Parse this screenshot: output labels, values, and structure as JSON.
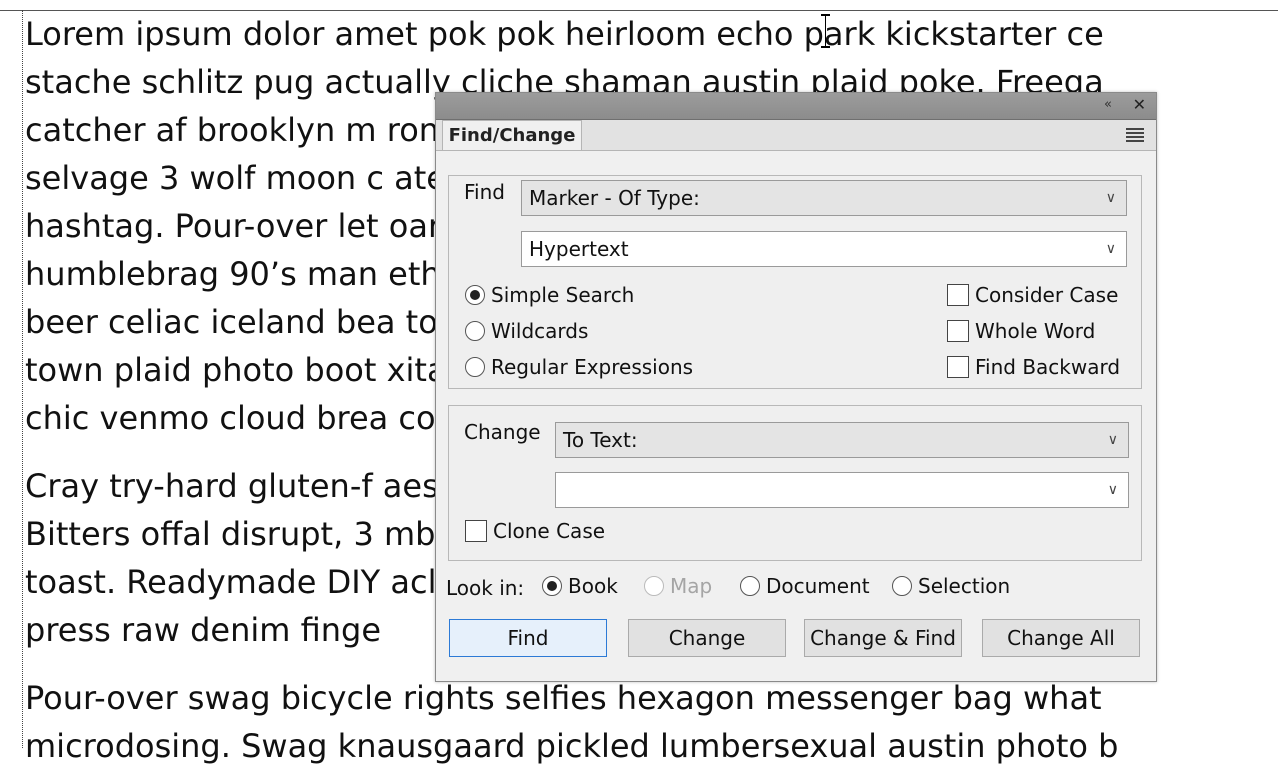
{
  "document": {
    "paragraphs": [
      [
        "Lorem ipsum dolor amet pok pok heirloom echo park kickstarter ce",
        "stache schlitz pug actually cliche shaman austin plaid poke. Freega",
        "catcher af brooklyn m                                                                                            ronut.",
        "selvage 3 wolf moon c                                                                                            ateboa",
        "hashtag. Pour-over let                                                                                          oard ph",
        "humblebrag 90’s man                                                                                              ethica",
        "beer celiac iceland bea                                                                                         torial s",
        "town plaid photo boot                                                                                          xitarian",
        "chic venmo cloud brea                                                                                           colorin"
      ],
      [
        "Cray try-hard gluten-f                                                                                          aesthet",
        "Bitters offal disrupt, 3                                                                                          mbleco",
        "toast. Readymade DIY                                                                                          aclette",
        "press raw denim finge"
      ],
      [
        "Pour-over swag bicycle rights selfies hexagon messenger bag what",
        "microdosing. Swag knausgaard pickled lumbersexual austin photo b"
      ]
    ]
  },
  "dialog": {
    "tab_label": "Find/Change",
    "find": {
      "label": "Find",
      "type_value": "Marker - Of Type:",
      "marker_value": "Hypertext",
      "search_modes": [
        "Simple Search",
        "Wildcards",
        "Regular Expressions"
      ],
      "selected_mode": "Simple Search",
      "options": [
        "Consider Case",
        "Whole Word",
        "Find Backward"
      ]
    },
    "change": {
      "label": "Change",
      "type_value": "To Text:",
      "text_value": "",
      "clone_case": "Clone Case"
    },
    "look_in": {
      "label": "Look in:",
      "options": [
        "Book",
        "Map",
        "Document",
        "Selection"
      ],
      "selected": "Book",
      "disabled": [
        "Map"
      ]
    },
    "buttons": {
      "find": "Find",
      "change": "Change",
      "change_find": "Change & Find",
      "change_all": "Change All"
    }
  },
  "colors": {
    "focus_border": "#2c7ad6"
  },
  "icons": {
    "collapse": "double-chevron-left-icon",
    "close": "close-icon",
    "menu": "panel-menu-icon",
    "dropdown": "chevron-down-icon"
  }
}
